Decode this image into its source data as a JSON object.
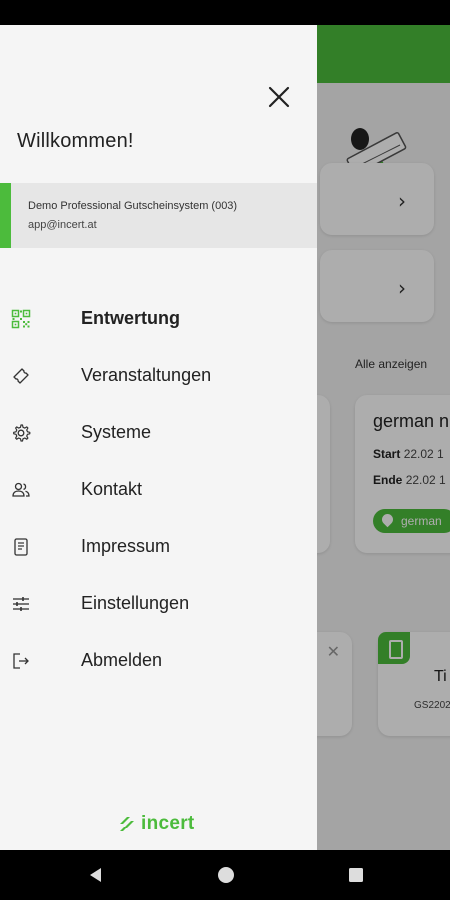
{
  "drawer": {
    "welcome": "Willkommen!",
    "account": {
      "name": "Demo Professional Gutscheinsystem (003)",
      "email": "app@incert.at"
    },
    "menu": [
      {
        "label": "Entwertung",
        "icon": "qr-code-icon",
        "active": true
      },
      {
        "label": "Veranstaltungen",
        "icon": "ticket-icon",
        "active": false
      },
      {
        "label": "Systeme",
        "icon": "gear-icon",
        "active": false
      },
      {
        "label": "Kontakt",
        "icon": "people-icon",
        "active": false
      },
      {
        "label": "Impressum",
        "icon": "document-icon",
        "active": false
      },
      {
        "label": "Einstellungen",
        "icon": "sliders-icon",
        "active": false
      },
      {
        "label": "Abmelden",
        "icon": "logout-icon",
        "active": false
      }
    ],
    "brand": "incert"
  },
  "background": {
    "see_all": "Alle anzeigen",
    "event": {
      "title": "german n",
      "start_label": "Start",
      "start_value": "22.02 1",
      "end_label": "Ende",
      "end_value": "22.02 1",
      "location": "german"
    },
    "ticket": {
      "title": "Ti",
      "code": "GS2202"
    }
  },
  "colors": {
    "accent": "#4cbb3c",
    "drawer_bg": "#f5f5f5",
    "account_bg": "#e6e6e6"
  }
}
